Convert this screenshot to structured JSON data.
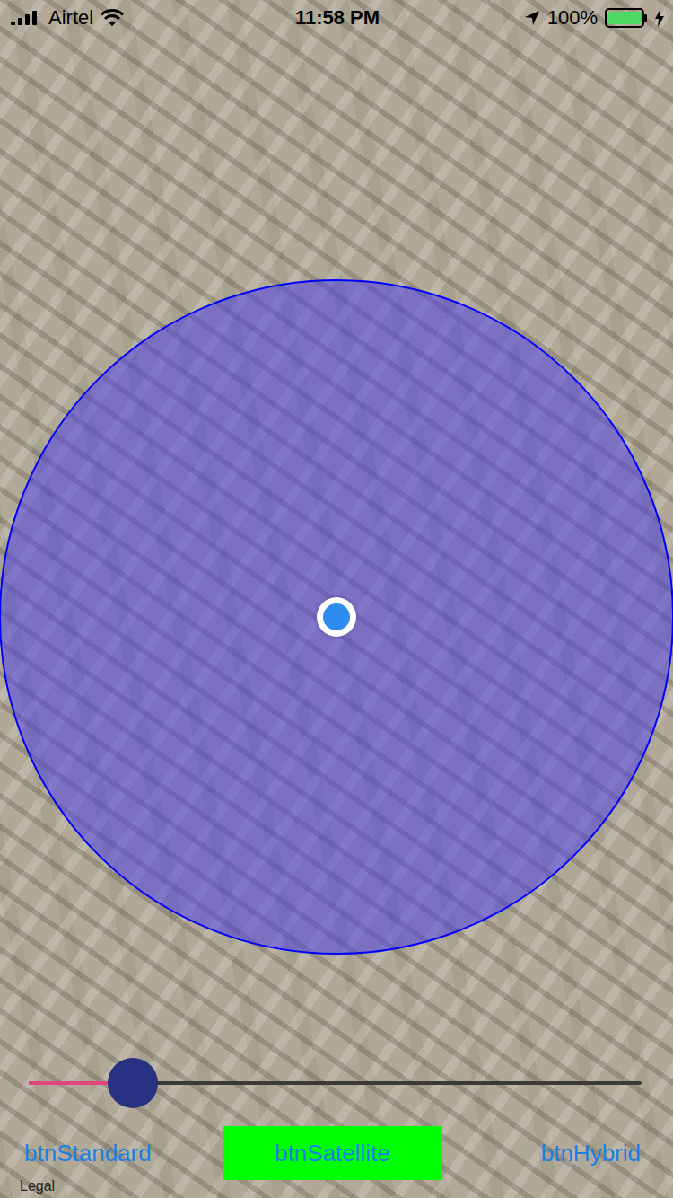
{
  "status_bar": {
    "carrier": "Airtel",
    "signal_bars": 4,
    "time": "11:58 PM",
    "battery_text": "100%",
    "battery_level": 1,
    "charging": true
  },
  "map": {
    "legal": "Legal"
  },
  "slider": {
    "level": 0.17
  },
  "buttons": [
    {
      "label": "btnStandard",
      "selected": false
    },
    {
      "label": "btnSatellite",
      "selected": true
    },
    {
      "label": "btnHybrid",
      "selected": false
    }
  ]
}
